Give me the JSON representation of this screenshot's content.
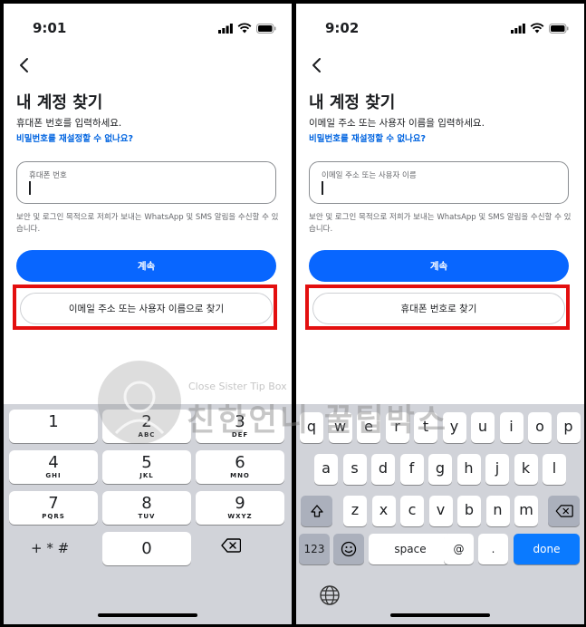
{
  "left": {
    "time": "9:01",
    "title": "내 계정 찾기",
    "description": "휴대폰 번호를 입력하세요.",
    "reset_link": "비밀번호를 재설정할 수 없나요?",
    "input_label": "휴대폰 번호",
    "notice": "보안 및 로그인 목적으로 저희가 보내는 WhatsApp 및 SMS 알림을 수신할 수 있습니다.",
    "continue_label": "계속",
    "alt_label": "이메일 주소 또는 사용자 이름으로 찾기",
    "numpad": [
      {
        "d": "1",
        "l": ""
      },
      {
        "d": "2",
        "l": "ABC"
      },
      {
        "d": "3",
        "l": "DEF"
      },
      {
        "d": "4",
        "l": "GHI"
      },
      {
        "d": "5",
        "l": "JKL"
      },
      {
        "d": "6",
        "l": "MNO"
      },
      {
        "d": "7",
        "l": "PQRS"
      },
      {
        "d": "8",
        "l": "TUV"
      },
      {
        "d": "9",
        "l": "WXYZ"
      }
    ],
    "symbols": "+ * #",
    "zero": "0"
  },
  "right": {
    "time": "9:02",
    "title": "내 계정 찾기",
    "description": "이메일 주소 또는 사용자 이름을 입력하세요.",
    "reset_link": "비밀번호를 재설정할 수 없나요?",
    "input_label": "이메일 주소 또는 사용자 이름",
    "notice": "보안 및 로그인 목적으로 저희가 보내는 WhatsApp 및 SMS 알림을 수신할 수 있습니다.",
    "continue_label": "계속",
    "alt_label": "휴대폰 번호로 찾기",
    "rows": [
      [
        "q",
        "w",
        "e",
        "r",
        "t",
        "y",
        "u",
        "i",
        "o",
        "p"
      ],
      [
        "a",
        "s",
        "d",
        "f",
        "g",
        "h",
        "j",
        "k",
        "l"
      ],
      [
        "z",
        "x",
        "c",
        "v",
        "b",
        "n",
        "m"
      ]
    ],
    "key_123": "123",
    "space": "space",
    "at": "@",
    "dot": ".",
    "done": "done"
  },
  "watermark": {
    "en": "Close Sister Tip Box",
    "ko": "친한언니 꿀팁박스"
  },
  "colors": {
    "primary": "#0866ff",
    "link": "#0064e0",
    "highlight": "#e30f0f",
    "done": "#0a7aff"
  }
}
